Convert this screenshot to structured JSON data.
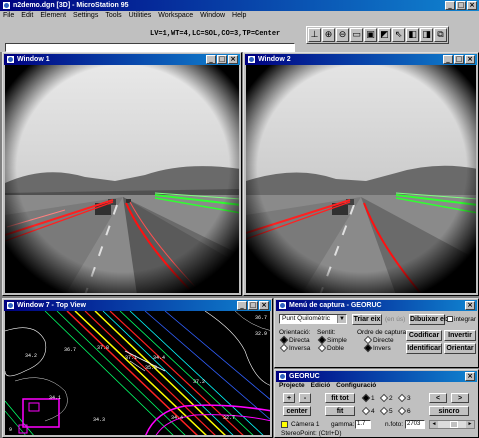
{
  "app": {
    "title": "n2demo.dgn [3D] - MicroStation 95",
    "status_line": "LV=1,WT=4,LC=SOL,CO=3,TP=Center"
  },
  "menu": [
    "File",
    "Edit",
    "Element",
    "Settings",
    "Tools",
    "Utilities",
    "Workspace",
    "Window",
    "Help"
  ],
  "toolbar_icons": [
    "level-icon",
    "zoom-in-icon",
    "zoom-out-icon",
    "window-area-icon",
    "fit-view-icon",
    "rotate-view-icon",
    "pan-view-icon",
    "view-previous-icon",
    "view-next-icon",
    "copy-view-icon"
  ],
  "windows": {
    "w1": {
      "title": "Window 1"
    },
    "w2": {
      "title": "Window 2"
    },
    "w7": {
      "title": "Window 7 - Top View",
      "labels": [
        "34.2",
        "36.7",
        "37.8",
        "37.1",
        "34.4",
        "34.1",
        "34.3",
        "35.8",
        "37.2",
        "32.7",
        "36.7",
        "32.9",
        "34.4",
        "9"
      ]
    }
  },
  "capture": {
    "title": "Menú de captura - GEORUC",
    "dropdown_value": "Punt Quilomètric",
    "triar_eix": "Triar eix",
    "eix_placeholder": "(en ús)",
    "dibuixar_eix": "Dibuixar eix",
    "integrar": "integrar",
    "orientacio": "Orientació:",
    "sentit": "Sentit:",
    "ordre": "Ordre de captura:",
    "directa": "Directa",
    "inversa": "Inversa",
    "simple": "Simple",
    "doble": "Doble",
    "directe": "Directe",
    "invers": "Invers",
    "codificar": "Codificar",
    "invertir": "Invertir",
    "identificar": "Identificar",
    "orientar": "Orientar"
  },
  "georuc": {
    "title": "GEORUC",
    "menu": [
      "Projecte",
      "Edició",
      "Configuració"
    ],
    "plus": "+",
    "minus": "-",
    "fit_tot": "fit tot",
    "center": "center",
    "fit": "fit",
    "prev": "<",
    "next": ">",
    "sincro": "sincro",
    "cams": [
      "1",
      "2",
      "3",
      "4",
      "5",
      "6"
    ],
    "camera_label": "Càmera 1",
    "gamma_label": "gamma:",
    "gamma_value": "1.7",
    "nfoto_label": "n.foto:",
    "nfoto_value": "2703",
    "stereo": "StereoPoint: (Ctrl+D)",
    "camera_color": "#ffff00"
  }
}
